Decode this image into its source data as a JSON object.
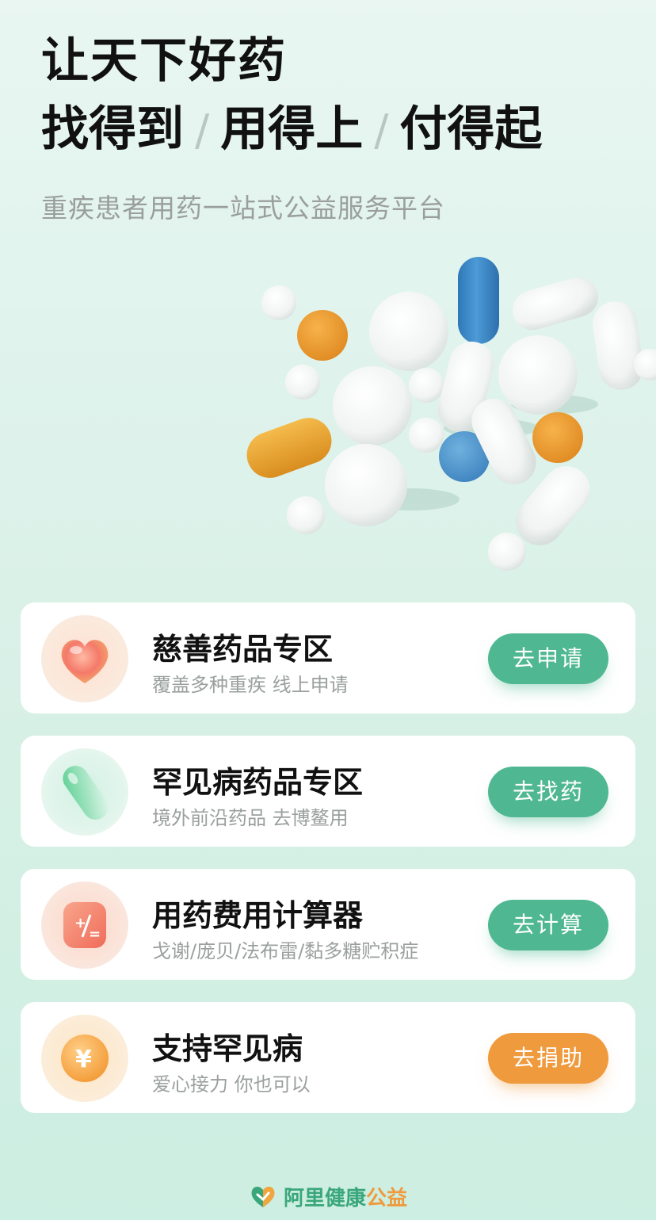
{
  "hero": {
    "title_line1": "让天下好药",
    "title_line2": [
      "找得到",
      "用得上",
      "付得起"
    ],
    "separator": "/",
    "subtitle": "重疾患者用药一站式公益服务平台"
  },
  "cards": [
    {
      "icon": "heart-icon",
      "title": "慈善药品专区",
      "desc": "覆盖多种重疾 线上申请",
      "action": "去申请",
      "action_color": "#4fb892"
    },
    {
      "icon": "capsule-icon",
      "title": "罕见病药品专区",
      "desc": "境外前沿药品 去博鳌用",
      "action": "去找药",
      "action_color": "#4fb892"
    },
    {
      "icon": "calculator-icon",
      "title": "用药费用计算器",
      "desc": "戈谢/庞贝/法布雷/黏多糖贮积症",
      "action": "去计算",
      "action_color": "#4fb892"
    },
    {
      "icon": "yuan-coin-icon",
      "title": "支持罕见病",
      "desc": "爱心接力 你也可以",
      "action": "去捐助",
      "action_color": "#ef9a3c"
    }
  ],
  "footer": {
    "logo_icon": "ali-health-logo-icon",
    "brand_part1": "阿里健康",
    "brand_part2": "公益"
  }
}
